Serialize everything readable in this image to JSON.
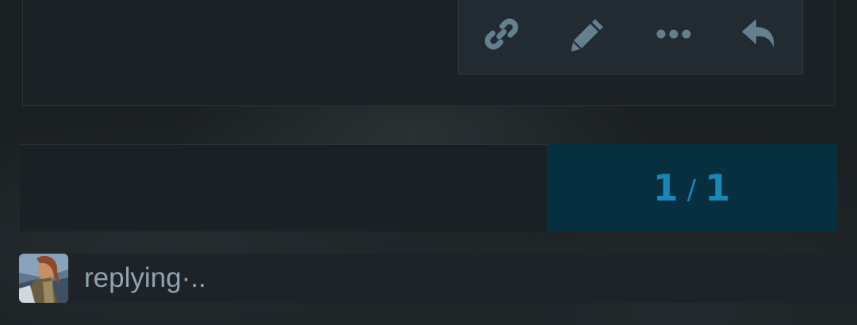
{
  "post": {
    "actions": [
      {
        "name": "link-icon",
        "label": "Copy link"
      },
      {
        "name": "pencil-icon",
        "label": "Edit"
      },
      {
        "name": "more-icon",
        "label": "More"
      },
      {
        "name": "reply-icon",
        "label": "Reply"
      }
    ]
  },
  "pager": {
    "current": "1",
    "separator": "/",
    "total": "1"
  },
  "composer": {
    "status_text": "replying·..",
    "avatar_name": "avatar"
  },
  "colors": {
    "accent": "#1a86b7",
    "pager_bg": "#06303f",
    "icon": "#62808e",
    "text_muted": "#8fa3b0",
    "page_bg": "#1a1f22"
  }
}
